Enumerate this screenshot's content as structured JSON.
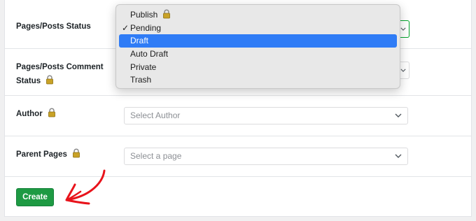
{
  "rows": [
    {
      "label": "Pages/Posts Status"
    },
    {
      "label_line1": "Pages/Posts Comment",
      "label_line2": "Status"
    },
    {
      "label": "Author",
      "placeholder": "Select Author"
    },
    {
      "label": "Parent Pages",
      "placeholder": "Select a page"
    }
  ],
  "dropdown": {
    "options": [
      "Publish",
      "Pending",
      "Draft",
      "Auto Draft",
      "Private",
      "Trash"
    ],
    "checked": "Pending",
    "highlighted": "Draft",
    "check_mark": "✓"
  },
  "create_label": "Create",
  "colors": {
    "accent": "#2f7cf6",
    "button": "#1e9a43",
    "annotation": "#e8131b"
  },
  "icons": {
    "lock": "lock-icon",
    "chevron": "chevron-down-icon",
    "arrow": "red-hand-drawn-arrow"
  }
}
